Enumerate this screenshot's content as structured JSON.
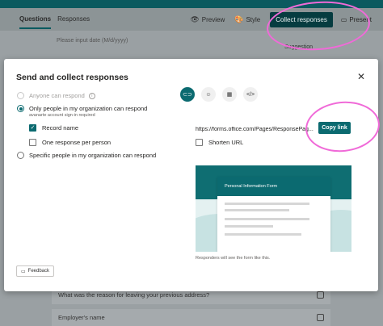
{
  "app": {
    "tabs": [
      "Questions",
      "Responses"
    ],
    "preview_label": "Preview",
    "style_label": "Style",
    "collect_label": "Collect responses",
    "present_label": "Present",
    "bg_input_placeholder": "Please input date (M/d/yyyy)",
    "suggestion_label": "Suggestion",
    "bg_questions": [
      "What was the reason for leaving your previous address?",
      "Employer's name"
    ]
  },
  "modal": {
    "title": "Send and collect responses",
    "options": {
      "anyone": "Anyone can respond",
      "org_only": "Only people in my organization can respond",
      "org_sub": "avanarte account sign-in required",
      "specific": "Specific people in my organization can respond"
    },
    "record_name": "Record name",
    "one_response": "One response per person",
    "feedback": "Feedback",
    "link_url": "https://forms.office.com/Pages/ResponsePag...",
    "copy_link": "Copy link",
    "shorten_url": "Shorten URL",
    "preview_title": "Personal Information Form",
    "preview_note": "Responders will see the form like this."
  },
  "colors": {
    "accent": "#0b6a70",
    "annotation": "#f06ad8"
  },
  "icons": [
    "link-icon",
    "people-icon",
    "qr-icon",
    "embed-icon"
  ]
}
